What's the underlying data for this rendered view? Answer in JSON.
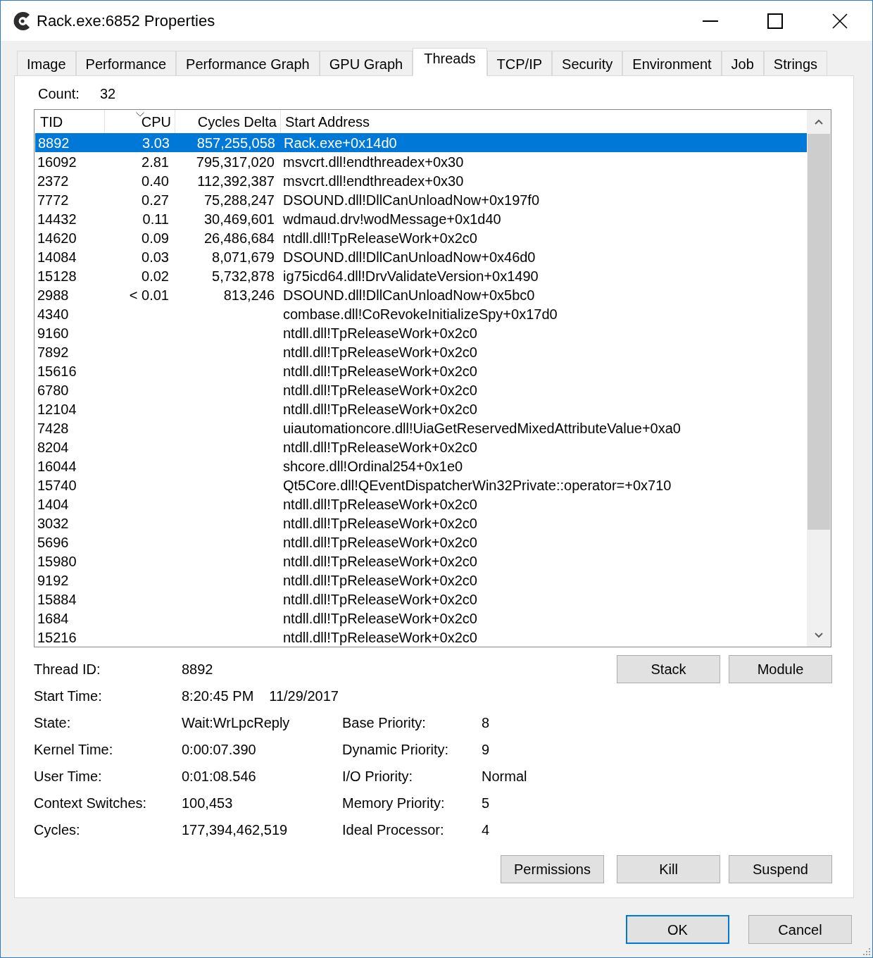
{
  "window": {
    "title": "Rack.exe:6852 Properties"
  },
  "tabs": [
    {
      "label": "Image",
      "selected": false
    },
    {
      "label": "Performance",
      "selected": false
    },
    {
      "label": "Performance Graph",
      "selected": false
    },
    {
      "label": "GPU Graph",
      "selected": false
    },
    {
      "label": "Threads",
      "selected": true
    },
    {
      "label": "TCP/IP",
      "selected": false
    },
    {
      "label": "Security",
      "selected": false
    },
    {
      "label": "Environment",
      "selected": false
    },
    {
      "label": "Job",
      "selected": false
    },
    {
      "label": "Strings",
      "selected": false
    }
  ],
  "count": {
    "label": "Count:",
    "value": "32"
  },
  "table": {
    "columns": [
      {
        "label": "TID",
        "sorted": false
      },
      {
        "label": "CPU",
        "sorted": true
      },
      {
        "label": "Cycles Delta",
        "sorted": false
      },
      {
        "label": "Start Address",
        "sorted": false
      }
    ],
    "rows": [
      {
        "tid": "8892",
        "cpu": "3.03",
        "cycles_delta": "857,255,058",
        "start_address": "Rack.exe+0x14d0",
        "selected": true
      },
      {
        "tid": "16092",
        "cpu": "2.81",
        "cycles_delta": "795,317,020",
        "start_address": "msvcrt.dll!endthreadex+0x30",
        "selected": false
      },
      {
        "tid": "2372",
        "cpu": "0.40",
        "cycles_delta": "112,392,387",
        "start_address": "msvcrt.dll!endthreadex+0x30",
        "selected": false
      },
      {
        "tid": "7772",
        "cpu": "0.27",
        "cycles_delta": "75,288,247",
        "start_address": "DSOUND.dll!DllCanUnloadNow+0x197f0",
        "selected": false
      },
      {
        "tid": "14432",
        "cpu": "0.11",
        "cycles_delta": "30,469,601",
        "start_address": "wdmaud.drv!wodMessage+0x1d40",
        "selected": false
      },
      {
        "tid": "14620",
        "cpu": "0.09",
        "cycles_delta": "26,486,684",
        "start_address": "ntdll.dll!TpReleaseWork+0x2c0",
        "selected": false
      },
      {
        "tid": "14084",
        "cpu": "0.03",
        "cycles_delta": "8,071,679",
        "start_address": "DSOUND.dll!DllCanUnloadNow+0x46d0",
        "selected": false
      },
      {
        "tid": "15128",
        "cpu": "0.02",
        "cycles_delta": "5,732,878",
        "start_address": "ig75icd64.dll!DrvValidateVersion+0x1490",
        "selected": false
      },
      {
        "tid": "2988",
        "cpu": "< 0.01",
        "cycles_delta": "813,246",
        "start_address": "DSOUND.dll!DllCanUnloadNow+0x5bc0",
        "selected": false
      },
      {
        "tid": "4340",
        "start_address": "combase.dll!CoRevokeInitializeSpy+0x17d0",
        "selected": false
      },
      {
        "tid": "9160",
        "start_address": "ntdll.dll!TpReleaseWork+0x2c0",
        "selected": false
      },
      {
        "tid": "7892",
        "start_address": "ntdll.dll!TpReleaseWork+0x2c0",
        "selected": false
      },
      {
        "tid": "15616",
        "start_address": "ntdll.dll!TpReleaseWork+0x2c0",
        "selected": false
      },
      {
        "tid": "6780",
        "start_address": "ntdll.dll!TpReleaseWork+0x2c0",
        "selected": false
      },
      {
        "tid": "12104",
        "start_address": "ntdll.dll!TpReleaseWork+0x2c0",
        "selected": false
      },
      {
        "tid": "7428",
        "start_address": "uiautomationcore.dll!UiaGetReservedMixedAttributeValue+0xa0",
        "selected": false
      },
      {
        "tid": "8204",
        "start_address": "ntdll.dll!TpReleaseWork+0x2c0",
        "selected": false
      },
      {
        "tid": "16044",
        "start_address": "shcore.dll!Ordinal254+0x1e0",
        "selected": false
      },
      {
        "tid": "15740",
        "start_address": "Qt5Core.dll!QEventDispatcherWin32Private::operator=+0x710",
        "selected": false
      },
      {
        "tid": "1404",
        "start_address": "ntdll.dll!TpReleaseWork+0x2c0",
        "selected": false
      },
      {
        "tid": "3032",
        "start_address": "ntdll.dll!TpReleaseWork+0x2c0",
        "selected": false
      },
      {
        "tid": "5696",
        "start_address": "ntdll.dll!TpReleaseWork+0x2c0",
        "selected": false
      },
      {
        "tid": "15980",
        "start_address": "ntdll.dll!TpReleaseWork+0x2c0",
        "selected": false
      },
      {
        "tid": "9192",
        "start_address": "ntdll.dll!TpReleaseWork+0x2c0",
        "selected": false
      },
      {
        "tid": "15884",
        "start_address": "ntdll.dll!TpReleaseWork+0x2c0",
        "selected": false
      },
      {
        "tid": "1684",
        "start_address": "ntdll.dll!TpReleaseWork+0x2c0",
        "selected": false
      },
      {
        "tid": "15216",
        "start_address": "ntdll.dll!TpReleaseWork+0x2c0",
        "selected": false
      }
    ]
  },
  "details": {
    "left": [
      {
        "label": "Thread ID:",
        "values": [
          "8892"
        ]
      },
      {
        "label": "Start Time:",
        "values": [
          "8:20:45 PM",
          "11/29/2017"
        ]
      },
      {
        "label": "State:",
        "values": [
          "Wait:WrLpcReply"
        ]
      },
      {
        "label": "Kernel Time:",
        "values": [
          "0:00:07.390"
        ]
      },
      {
        "label": "User Time:",
        "values": [
          "0:01:08.546"
        ]
      },
      {
        "label": "Context Switches:",
        "values": [
          "100,453"
        ]
      },
      {
        "label": "Cycles:",
        "values": [
          "177,394,462,519"
        ]
      }
    ],
    "right": [
      {
        "label": "Base Priority:",
        "value": "8"
      },
      {
        "label": "Dynamic Priority:",
        "value": "9"
      },
      {
        "label": "I/O Priority:",
        "value": "Normal"
      },
      {
        "label": "Memory Priority:",
        "value": "5"
      },
      {
        "label": "Ideal Processor:",
        "value": "4"
      }
    ]
  },
  "thread_buttons": [
    {
      "label": "Stack"
    },
    {
      "label": "Module"
    }
  ],
  "action_buttons": [
    {
      "label": "Permissions"
    },
    {
      "label": "Kill"
    },
    {
      "label": "Suspend"
    }
  ],
  "dialog_buttons": [
    {
      "label": "OK",
      "default": true
    },
    {
      "label": "Cancel",
      "default": false
    }
  ]
}
